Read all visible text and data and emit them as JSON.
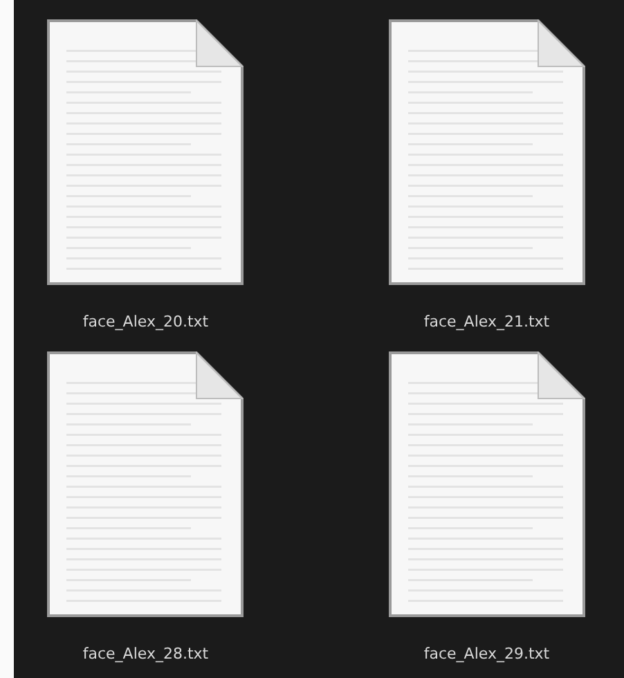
{
  "files": [
    {
      "name": "face_Alex_20.txt",
      "kind": "text-file"
    },
    {
      "name": "face_Alex_21.txt",
      "kind": "text-file"
    },
    {
      "name": "face_Alex_28.txt",
      "kind": "text-file"
    },
    {
      "name": "face_Alex_29.txt",
      "kind": "text-file"
    }
  ]
}
